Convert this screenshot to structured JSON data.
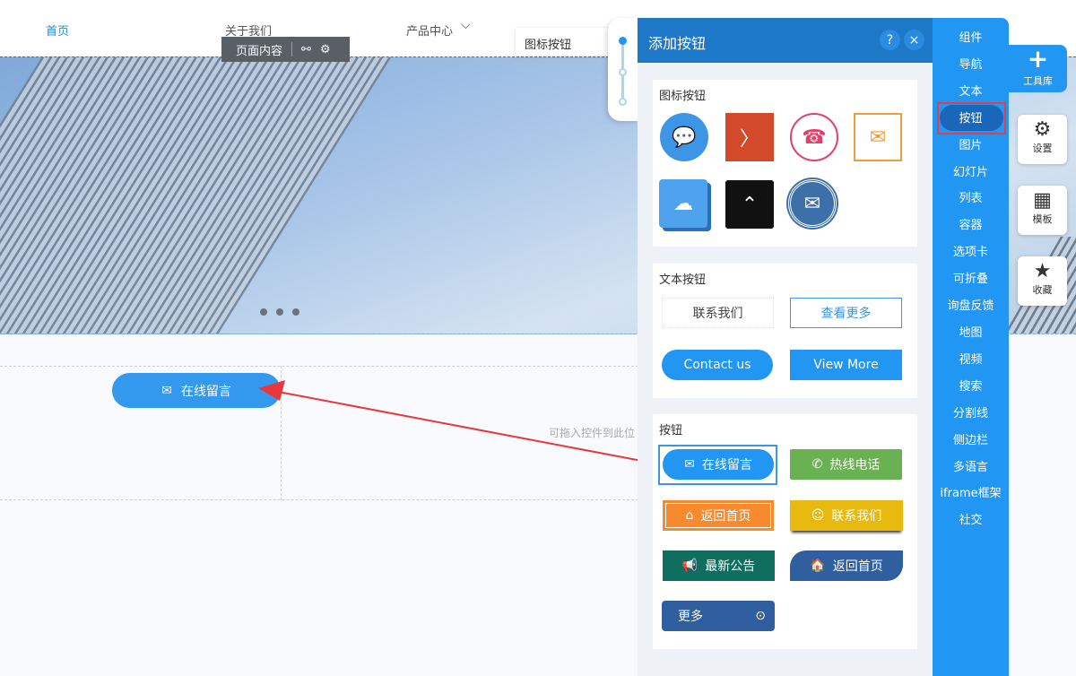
{
  "nav": {
    "items": [
      "首页",
      "关于我们",
      "产品中心"
    ],
    "chevron": "chevron-down-icon"
  },
  "toolbar": {
    "label": "页面内容",
    "icons": [
      "unlink-icon",
      "gear-icon"
    ]
  },
  "tooltip": "图标按钮",
  "canvas": {
    "button_label": "在线留言",
    "drop_hint": "可拖入控件到此位"
  },
  "panel": {
    "title": "添加按钮",
    "help": "?",
    "close": "×",
    "icon_section": "图标按钮",
    "text_section": "文本按钮",
    "text_buttons": [
      "联系我们",
      "查看更多",
      "Contact us",
      "View More"
    ],
    "btn_section": "按钮",
    "buttons": [
      "在线留言",
      "热线电话",
      "返回首页",
      "联系我们",
      "最新公告",
      "返回首页",
      "更多"
    ]
  },
  "sidebar": {
    "items": [
      "组件",
      "导航",
      "文本",
      "按钮",
      "图片",
      "幻灯片",
      "列表",
      "容器",
      "选项卡",
      "可折叠",
      "询盘反馈",
      "地图",
      "视频",
      "搜索",
      "分割线",
      "侧边栏",
      "多语言",
      "iframe框架",
      "社交"
    ],
    "active": "按钮"
  },
  "tools": {
    "library": "工具库",
    "settings": "设置",
    "template": "模板",
    "favorites": "收藏"
  },
  "colors": {
    "accent": "#2196f3",
    "header": "#1e78c8",
    "highlight": "#e0404a"
  }
}
